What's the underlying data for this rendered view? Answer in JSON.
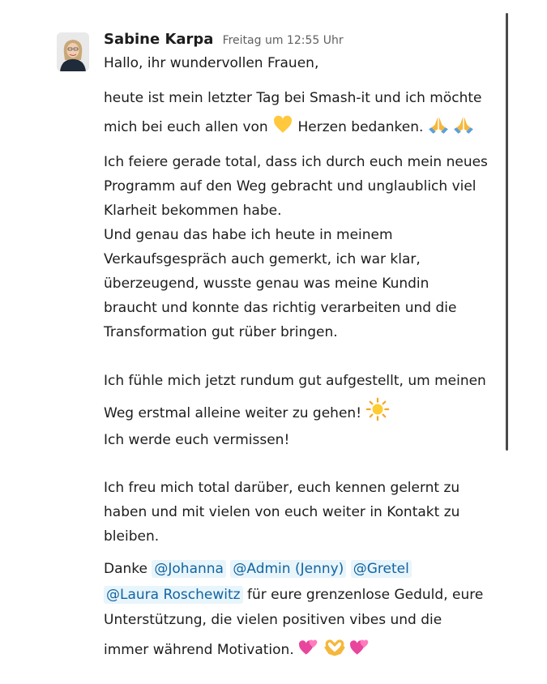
{
  "message": {
    "author": "Sabine Karpa",
    "timestamp": "Freitag um 12:55 Uhr",
    "greeting": "Hallo, ihr wundervollen Frauen,",
    "p1_line1": "heute ist mein letzter Tag bei Smash-it und ich möchte",
    "p1_line2_a": "mich bei euch allen von",
    "p1_line2_b": "Herzen bedanken.",
    "p2_lines": [
      "Ich feiere gerade total, dass ich durch euch mein neues",
      "Programm auf den Weg gebracht und unglaublich viel",
      "Klarheit bekommen habe.",
      "Und genau das habe ich heute in meinem",
      "Verkaufsgespräch auch gemerkt, ich war klar,",
      "überzeugend, wusste genau was meine Kundin",
      "braucht und konnte das richtig verarbeiten und die",
      "Transformation gut rüber bringen."
    ],
    "p3_line1": "Ich fühle mich jetzt rundum gut aufgestellt, um meinen",
    "p3_line2": "Weg erstmal alleine weiter zu gehen!",
    "p4": "Ich werde euch vermissen!",
    "p5_lines": [
      "Ich freu mich total darüber, euch kennen gelernt zu",
      "haben und mit vielen von euch weiter in Kontakt zu",
      "bleiben."
    ],
    "thanks_word": "Danke",
    "mentions": [
      "@Johanna",
      "@Admin (Jenny)",
      "@Gretel",
      "@Laura Roschewitz"
    ],
    "p6_line2_rest": "für eure grenzenlose Geduld, eure",
    "p6_line3": "Unterstützung, die vielen positiven vibes und die",
    "p6_line4": "immer während Motivation."
  },
  "emojis": {
    "heart": "yellow-heart",
    "pray": "folded-hands",
    "sun": "sun",
    "hearts": "two-hearts",
    "heart_hands": "heart-hands"
  },
  "colors": {
    "mention_bg": "#e8f5fa",
    "mention_text": "#1264a3",
    "text": "#1d1c1d",
    "timestamp": "#616061"
  }
}
